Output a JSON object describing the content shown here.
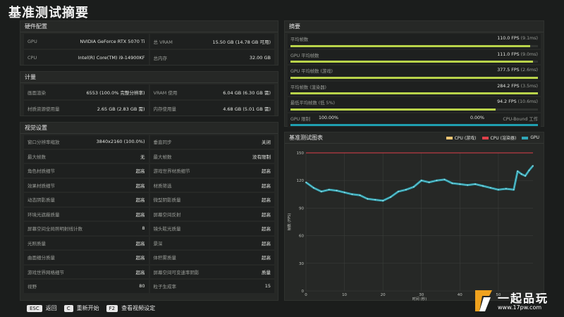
{
  "title": "基准测试摘要",
  "hardware": {
    "heading": "硬件配置",
    "rows": [
      [
        {
          "label": "GPU",
          "value": "NVIDIA GeForce RTX 5070 Ti"
        },
        {
          "label": "总 VRAM",
          "value": "15.50 GB (14.78 GB 可用)"
        }
      ],
      [
        {
          "label": "CPU",
          "value": "Intel(R) Core(TM) i9-14900KF"
        },
        {
          "label": "总内存",
          "value": "32.00 GB"
        }
      ]
    ]
  },
  "metrics": {
    "heading": "计量",
    "rows": [
      [
        {
          "label": "画面渲染",
          "value": "6553 (100.0% 完整分辨率)"
        },
        {
          "label": "VRAM 使用",
          "value": "6.04 GB (6.30 GB 需)"
        }
      ],
      [
        {
          "label": "材质资源使用量",
          "value": "2.65 GB (2.83 GB 需)"
        },
        {
          "label": "内存使用量",
          "value": "4.68 GB (5.01 GB 需)"
        }
      ]
    ]
  },
  "visual": {
    "heading": "视觉设置",
    "rows": [
      [
        {
          "label": "窗口分辨率缩放",
          "value": "3840x2160 (100.0%)"
        },
        {
          "label": "垂直同步",
          "value": "关闭"
        }
      ],
      [
        {
          "label": "最大帧数",
          "value": "无"
        },
        {
          "label": "最大帧数",
          "value": "没有限制"
        }
      ],
      [
        {
          "label": "角色材质细节",
          "value": "超高"
        },
        {
          "label": "游戏世界材质细节",
          "value": "超高"
        }
      ],
      [
        {
          "label": "效果材质细节",
          "value": "超高"
        },
        {
          "label": "材质筛选",
          "value": "超高"
        }
      ],
      [
        {
          "label": "动态阴影质量",
          "value": "超高"
        },
        {
          "label": "微型阴影质量",
          "value": "超高"
        }
      ],
      [
        {
          "label": "环境光遮蔽质量",
          "value": "超高"
        },
        {
          "label": "屏幕空间反射",
          "value": "超高"
        }
      ],
      [
        {
          "label": "屏幕空间全局照明射线计数",
          "value": "8"
        },
        {
          "label": "镜头眩光质量",
          "value": "超高"
        }
      ],
      [
        {
          "label": "光照质量",
          "value": "超高"
        },
        {
          "label": "景深",
          "value": "超高"
        }
      ],
      [
        {
          "label": "曲面细分质量",
          "value": "超高"
        },
        {
          "label": "体积雾质量",
          "value": "超高"
        }
      ],
      [
        {
          "label": "游戏世界网格细节",
          "value": "超高"
        },
        {
          "label": "屏幕空间可变速率阴影",
          "value": "质量"
        }
      ],
      [
        {
          "label": "视野",
          "value": "80"
        },
        {
          "label": "粒子生成率",
          "value": "15"
        }
      ]
    ]
  },
  "summary": {
    "heading": "摘要",
    "rows": [
      {
        "label": "平均帧数",
        "value": "110.0 FPS",
        "sub": "(9.1ms)",
        "fill": 0.97
      },
      {
        "label": "GPU 平均帧数",
        "value": "111.0 FPS",
        "sub": "(9.0ms)",
        "fill": 0.98
      },
      {
        "label": "GPU 平均帧数 (游戏)",
        "value": "377.5 FPS",
        "sub": "(2.6ms)",
        "fill": 1.0
      },
      {
        "label": "平均帧数 (渲染器)",
        "value": "284.2 FPS",
        "sub": "(3.5ms)",
        "fill": 1.0
      },
      {
        "label": "最低平均帧数 (低 5%)",
        "value": "94.2 FPS",
        "sub": "(10.6ms)",
        "fill": 0.83
      }
    ],
    "gpu_bound": {
      "label": "GPU 限制",
      "pct1": "100.00%",
      "pct2": "0.00%",
      "tail": "CPU-Bound 工作",
      "fill": 1.0
    }
  },
  "chart_panel": {
    "heading": "基准测试图表"
  },
  "chart_data": {
    "type": "line",
    "title": "",
    "xlabel": "时间 (秒)",
    "ylabel": "帧数 (FPS)",
    "xlim": [
      0,
      59
    ],
    "ylim": [
      0,
      150
    ],
    "x_ticks": [
      0,
      10,
      20,
      30,
      40,
      50
    ],
    "y_ticks": [
      0,
      30,
      60,
      90,
      120,
      150
    ],
    "grid": true,
    "legend": "top-right",
    "series": [
      {
        "name": "CPU (游戏)",
        "color": "#f0c674",
        "values_note": "off-scale"
      },
      {
        "name": "CPU (渲染器)",
        "color": "#e0404a",
        "constant": 150
      },
      {
        "name": "GPU",
        "color": "#2fa7b8",
        "x": [
          0,
          2,
          4,
          6,
          8,
          10,
          12,
          14,
          16,
          18,
          20,
          22,
          24,
          26,
          28,
          30,
          32,
          34,
          36,
          38,
          40,
          42,
          44,
          46,
          48,
          50,
          52,
          54,
          55,
          56,
          57,
          58,
          59
        ],
        "values": [
          118,
          112,
          108,
          110,
          109,
          107,
          105,
          104,
          100,
          99,
          98,
          102,
          108,
          110,
          113,
          120,
          118,
          120,
          121,
          117,
          116,
          115,
          116,
          114,
          112,
          110,
          111,
          110,
          130,
          127,
          125,
          131,
          136
        ]
      }
    ]
  },
  "footer": [
    {
      "key": "ESC",
      "label": "返回"
    },
    {
      "key": "C",
      "label": "重新开始"
    },
    {
      "key": "F2",
      "label": "查看视频设定"
    }
  ],
  "watermark": {
    "name": "一起品玩",
    "url": "www.17pw.com"
  },
  "colors": {
    "accent": "#b9d34a",
    "gpu": "#2fa7b8",
    "cpu_render": "#e0404a",
    "cpu_game": "#f0c674"
  }
}
